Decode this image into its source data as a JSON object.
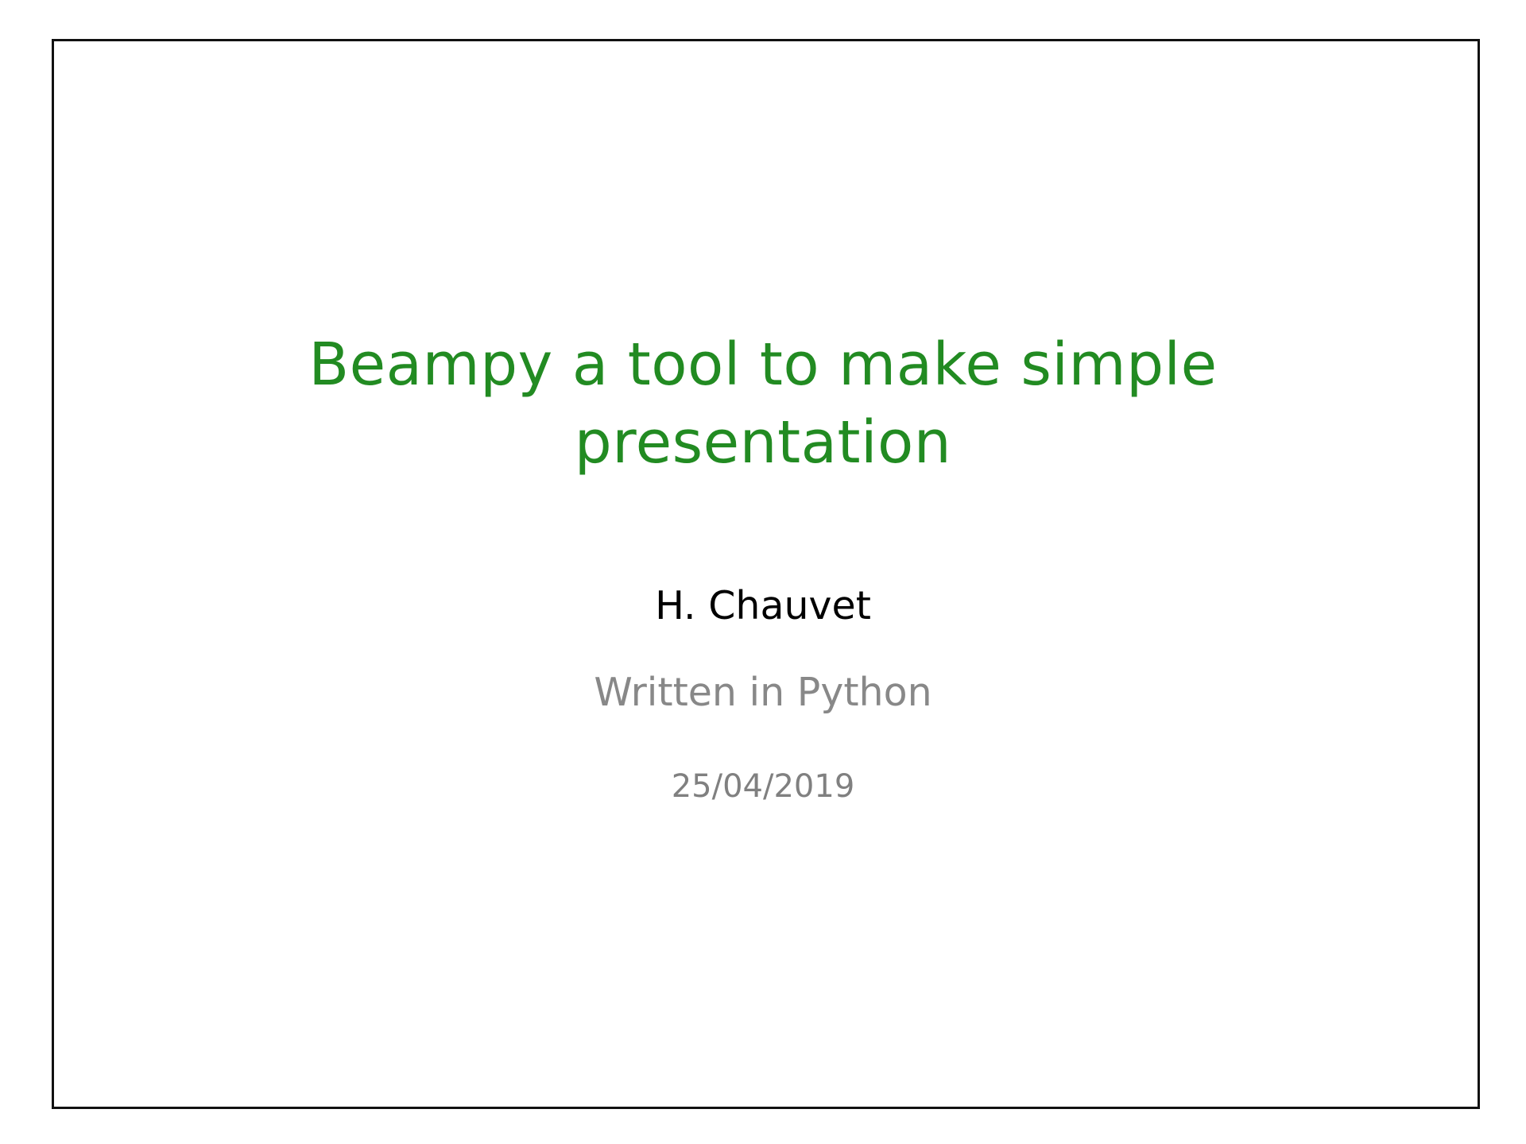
{
  "slide": {
    "title_lines": [
      "Beampy a tool to make simple",
      "presentation"
    ],
    "author": "H. Chauvet",
    "subtitle": "Written in Python",
    "date": "25/04/2019"
  },
  "colors": {
    "title": "#228b22",
    "author": "#000000",
    "subtitle": "#888888",
    "date": "#808080",
    "frame": "#111111",
    "background": "#ffffff"
  }
}
